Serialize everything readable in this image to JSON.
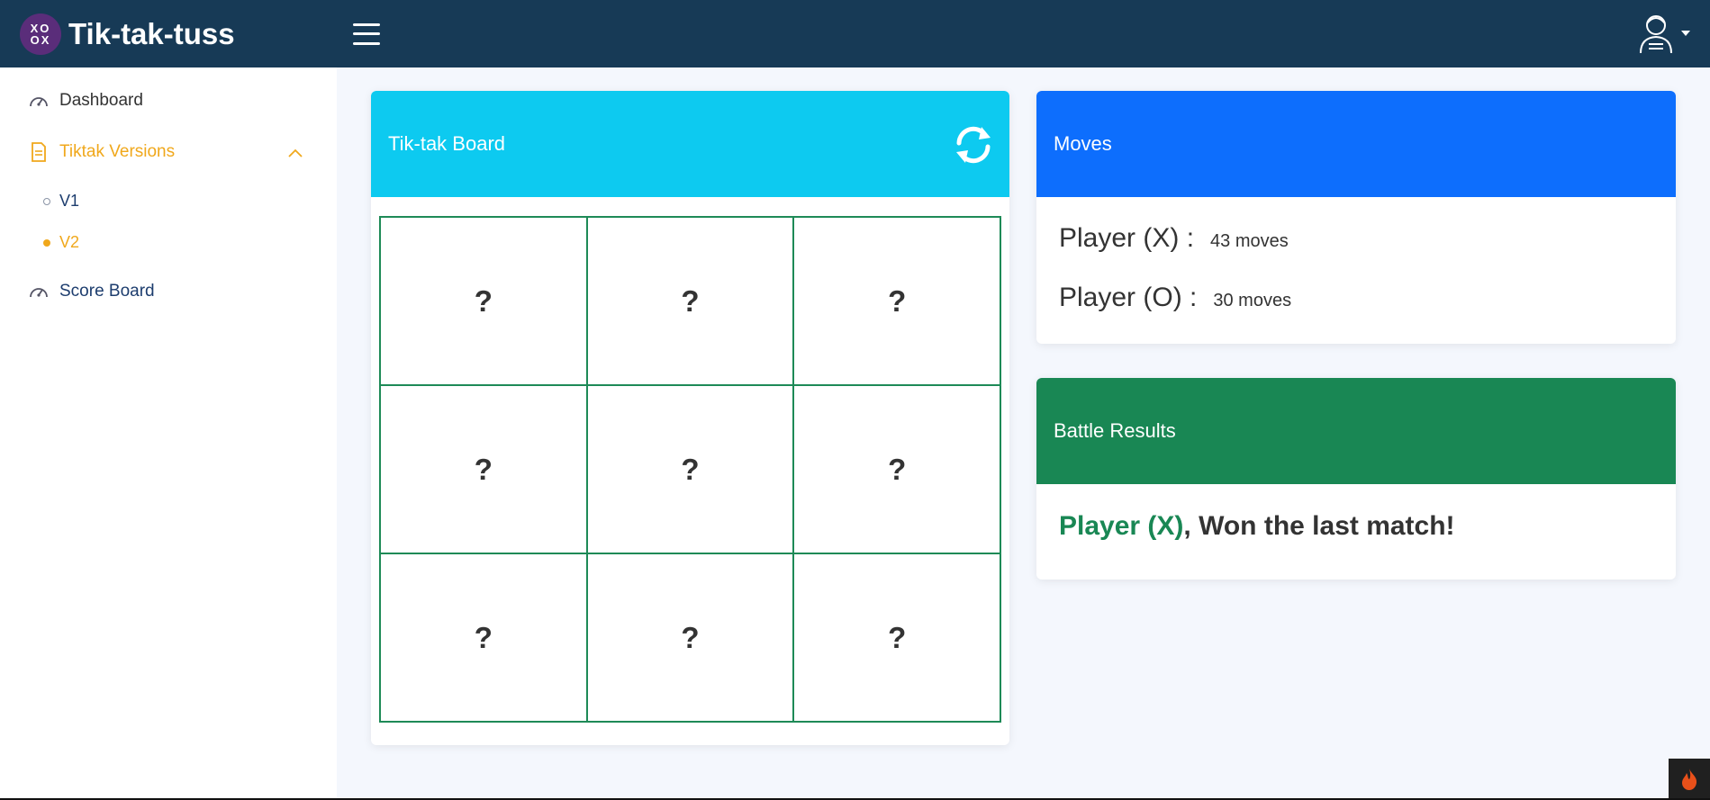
{
  "header": {
    "logo_top": "XO",
    "logo_bottom": "OX",
    "brand": "Tik-tak-tuss"
  },
  "sidebar": {
    "items": [
      {
        "label": "Dashboard"
      },
      {
        "label": "Tiktak Versions"
      },
      {
        "label": "Score Board"
      }
    ],
    "sub_items": [
      {
        "label": "V1"
      },
      {
        "label": "V2"
      }
    ]
  },
  "board_card": {
    "title": "Tik-tak Board",
    "cells": [
      "?",
      "?",
      "?",
      "?",
      "?",
      "?",
      "?",
      "?",
      "?"
    ]
  },
  "moves_card": {
    "title": "Moves",
    "players": [
      {
        "label": "Player (X) :",
        "moves": "43 moves"
      },
      {
        "label": "Player (O) :",
        "moves": "30 moves"
      }
    ]
  },
  "results_card": {
    "title": "Battle Results",
    "winner": "Player (X)",
    "message": ", Won the last match!"
  },
  "colors": {
    "header_bg": "#173a56",
    "board_header": "#0dcaf0",
    "moves_header": "#0d6efd",
    "results_header": "#198754",
    "active_nav": "#f0a81c",
    "grid_line": "#1e8a57"
  }
}
